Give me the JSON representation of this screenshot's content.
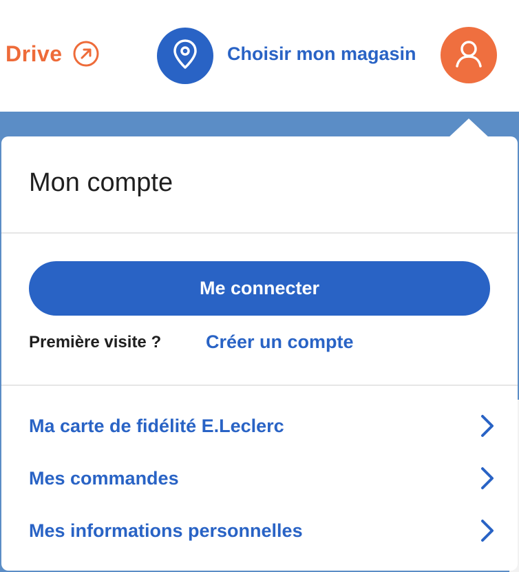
{
  "header": {
    "drive_label": "Drive",
    "store_label": "Choisir mon magasin"
  },
  "account_panel": {
    "title": "Mon compte",
    "connect_button": "Me connecter",
    "first_visit_label": "Première visite ?",
    "create_account_link": "Créer un compte",
    "menu_items": [
      {
        "label": "Ma carte de fidélité E.Leclerc"
      },
      {
        "label": "Mes commandes"
      },
      {
        "label": "Mes informations personnelles"
      }
    ]
  },
  "colors": {
    "brand_blue": "#2963c5",
    "brand_orange": "#ef6f3f",
    "backdrop_blue": "#5b8dc6"
  },
  "icons": {
    "drive": "external-arrow-icon",
    "store": "map-pin-icon",
    "account": "user-icon",
    "menu": "chevron-right-icon"
  }
}
